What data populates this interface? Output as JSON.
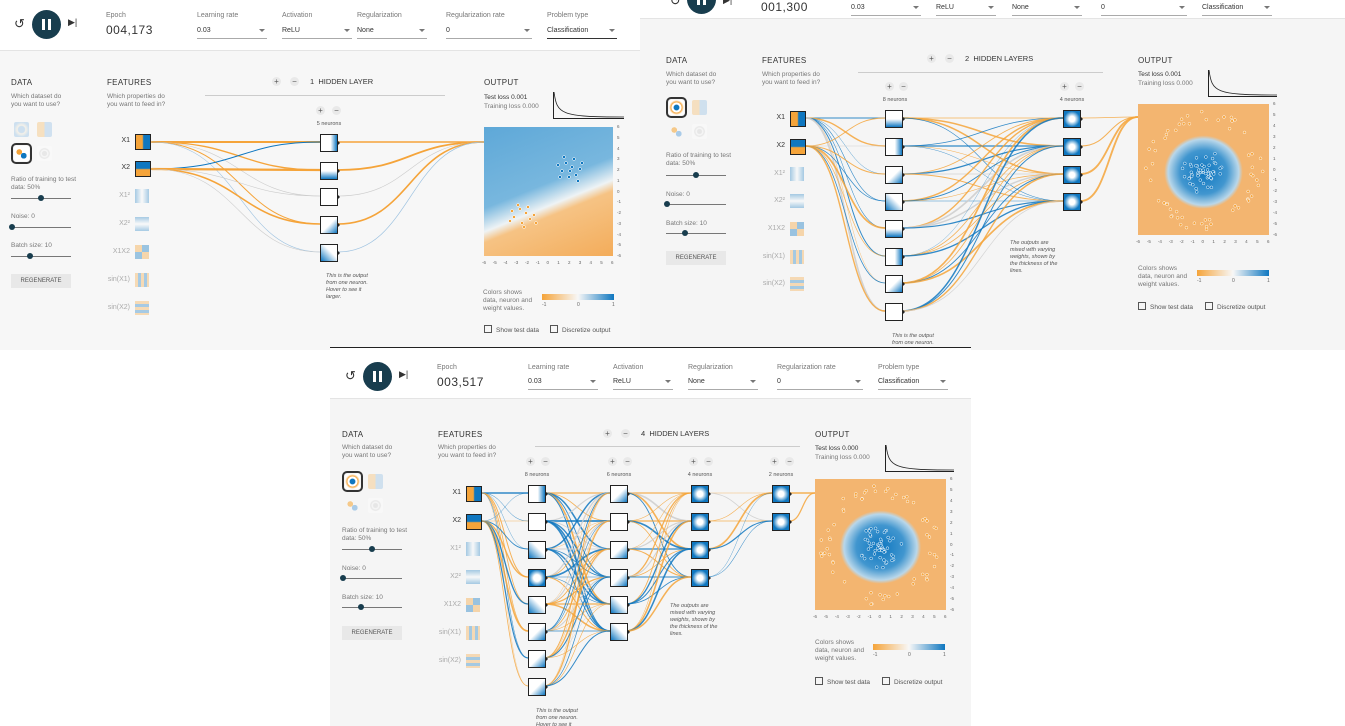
{
  "panels": [
    {
      "epoch_label": "Epoch",
      "epoch": "004,173",
      "learning_rate_label": "Learning rate",
      "learning_rate": "0.03",
      "activation_label": "Activation",
      "activation": "ReLU",
      "regularization_label": "Regularization",
      "regularization": "None",
      "regularization_rate_label": "Regularization rate",
      "regularization_rate": "0",
      "problem_type_label": "Problem type",
      "problem_type": "Classification",
      "data_heading": "DATA",
      "data_sub": "Which dataset do you want to use?",
      "ratio_label": "Ratio of training to test data:",
      "ratio": "50%",
      "noise_label": "Noise:",
      "noise": "0",
      "batch_label": "Batch size:",
      "batch": "10",
      "regenerate": "REGENERATE",
      "features_heading": "FEATURES",
      "features_sub": "Which properties do you want to feed in?",
      "features": [
        "X1",
        "X2",
        "X1²",
        "X2²",
        "X1X2",
        "sin(X1)",
        "sin(X2)"
      ],
      "hidden_count": "1",
      "hidden_label": "HIDDEN LAYER",
      "layers": [
        "5 neurons"
      ],
      "annotation": "This is the output from one neuron. Hover to see it larger.",
      "output_heading": "OUTPUT",
      "test_loss": "Test loss 0.001",
      "training_loss": "Training loss 0.000",
      "colors_text": "Colors shows data, neuron and weight values.",
      "cb_ticks": [
        "-1",
        "0",
        "1"
      ],
      "show_test": "Show test data",
      "discretize": "Discretize output",
      "axis_ticks": [
        "-6",
        "-5",
        "-4",
        "-3",
        "-2",
        "-1",
        "0",
        "1",
        "2",
        "3",
        "4",
        "5",
        "6"
      ]
    },
    {
      "epoch": "001,300",
      "learning_rate": "0.03",
      "activation": "ReLU",
      "regularization": "None",
      "regularization_rate": "0",
      "problem_type": "Classification",
      "data_heading": "DATA",
      "data_sub": "Which dataset do you want to use?",
      "ratio_label": "Ratio of training to test data:",
      "ratio": "50%",
      "noise_label": "Noise:",
      "noise": "0",
      "batch_label": "Batch size:",
      "batch": "10",
      "regenerate": "REGENERATE",
      "features_heading": "FEATURES",
      "features_sub": "Which properties do you want to feed in?",
      "features": [
        "X1",
        "X2",
        "X1²",
        "X2²",
        "X1X2",
        "sin(X1)",
        "sin(X2)"
      ],
      "hidden_count": "2",
      "hidden_label": "HIDDEN LAYERS",
      "layers": [
        "8 neurons",
        "4 neurons"
      ],
      "annotation": "This is the output from one neuron.",
      "annotation2": "The outputs are mixed with varying weights, shown by the thickness of the lines.",
      "output_heading": "OUTPUT",
      "test_loss": "Test loss 0.001",
      "training_loss": "Training loss 0.000",
      "colors_text": "Colors shows data, neuron and weight values.",
      "cb_ticks": [
        "-1",
        "0",
        "1"
      ],
      "show_test": "Show test data",
      "discretize": "Discretize output",
      "axis_ticks": [
        "-6",
        "-5",
        "-4",
        "-3",
        "-2",
        "-1",
        "0",
        "1",
        "2",
        "3",
        "4",
        "5",
        "6"
      ]
    },
    {
      "epoch_label": "Epoch",
      "epoch": "003,517",
      "learning_rate_label": "Learning rate",
      "learning_rate": "0.03",
      "activation_label": "Activation",
      "activation": "ReLU",
      "regularization_label": "Regularization",
      "regularization": "None",
      "regularization_rate_label": "Regularization rate",
      "regularization_rate": "0",
      "problem_type_label": "Problem type",
      "problem_type": "Classification",
      "data_heading": "DATA",
      "data_sub": "Which dataset do you want to use?",
      "ratio_label": "Ratio of training to test data:",
      "ratio": "50%",
      "noise_label": "Noise:",
      "noise": "0",
      "batch_label": "Batch size:",
      "batch": "10",
      "regenerate": "REGENERATE",
      "features_heading": "FEATURES",
      "features_sub": "Which properties do you want to feed in?",
      "features": [
        "X1",
        "X2",
        "X1²",
        "X2²",
        "X1X2",
        "sin(X1)",
        "sin(X2)"
      ],
      "hidden_count": "4",
      "hidden_label": "HIDDEN LAYERS",
      "layers": [
        "8 neurons",
        "6 neurons",
        "4 neurons",
        "2 neurons"
      ],
      "annotation": "This is the output from one neuron. Hover to see it",
      "annotation2": "The outputs are mixed with varying weights, shown by the thickness of the lines.",
      "output_heading": "OUTPUT",
      "test_loss": "Test loss 0.000",
      "training_loss": "Training loss 0.000",
      "colors_text": "Colors shows data, neuron and weight values.",
      "cb_ticks": [
        "-1",
        "0",
        "1"
      ],
      "show_test": "Show test data",
      "discretize": "Discretize output",
      "axis_ticks": [
        "-6",
        "-5",
        "-4",
        "-3",
        "-2",
        "-1",
        "0",
        "1",
        "2",
        "3",
        "4",
        "5",
        "6"
      ]
    }
  ],
  "colors": {
    "orange": "#f5a43a",
    "blue": "#0f77c0",
    "dark": "#183d4e"
  }
}
